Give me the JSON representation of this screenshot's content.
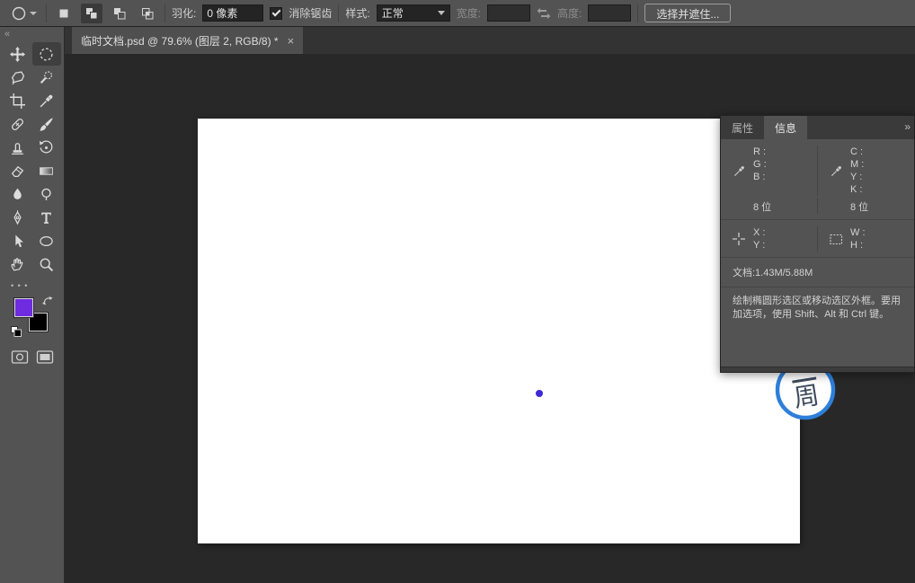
{
  "options_bar": {
    "feather_label": "羽化:",
    "feather_value": "0 像素",
    "antialias_label": "消除锯齿",
    "style_label": "样式:",
    "style_value": "正常",
    "width_label": "宽度:",
    "width_value": "",
    "height_label": "高度:",
    "height_value": "",
    "select_mask_label": "选择并遮住...",
    "mode_icons": [
      "new-selection-icon",
      "add-selection-icon",
      "subtract-selection-icon",
      "intersect-selection-icon"
    ]
  },
  "tab": {
    "title": "临时文档.psd @ 79.6% (图层 2, RGB/8) *",
    "close_glyph": "×"
  },
  "toolbar": {
    "collapse_glyph": "«",
    "edit_toolbar_glyph": "• • •",
    "tools": [
      "move",
      "elliptical-marquee",
      "lasso",
      "quick-selection",
      "crop",
      "eyedropper",
      "healing-brush",
      "brush",
      "clone-stamp",
      "history-brush",
      "eraser",
      "gradient",
      "blur",
      "dodge",
      "pen",
      "type",
      "path-selection",
      "ellipse-shape",
      "hand",
      "zoom"
    ],
    "active_tool": "elliptical-marquee",
    "foreground_color": "#6e2be0",
    "background_color": "#000000"
  },
  "canvas": {
    "dot_color": "#3d2ad6",
    "logo": {
      "char": "周",
      "ring_color": "#2e7fd9",
      "text_color": "#3c4a5c"
    }
  },
  "panel": {
    "tabs": [
      {
        "label": "属性"
      },
      {
        "label": "信息"
      }
    ],
    "active_tab": "信息",
    "collapse_glyph": "»",
    "rgb_labels": [
      "R :",
      "G :",
      "B :"
    ],
    "rgb_bits": "8 位",
    "cmyk_labels": [
      "C :",
      "M :",
      "Y :",
      "K :"
    ],
    "cmyk_bits": "8 位",
    "xy_labels": [
      "X :",
      "Y :"
    ],
    "wh_labels": [
      "W :",
      "H :"
    ],
    "doc_info": "文档:1.43M/5.88M",
    "tip_line1": "绘制椭圆形选区或移动选区外框。要用",
    "tip_line2": "加选项，使用 Shift、Alt 和 Ctrl 键。"
  }
}
